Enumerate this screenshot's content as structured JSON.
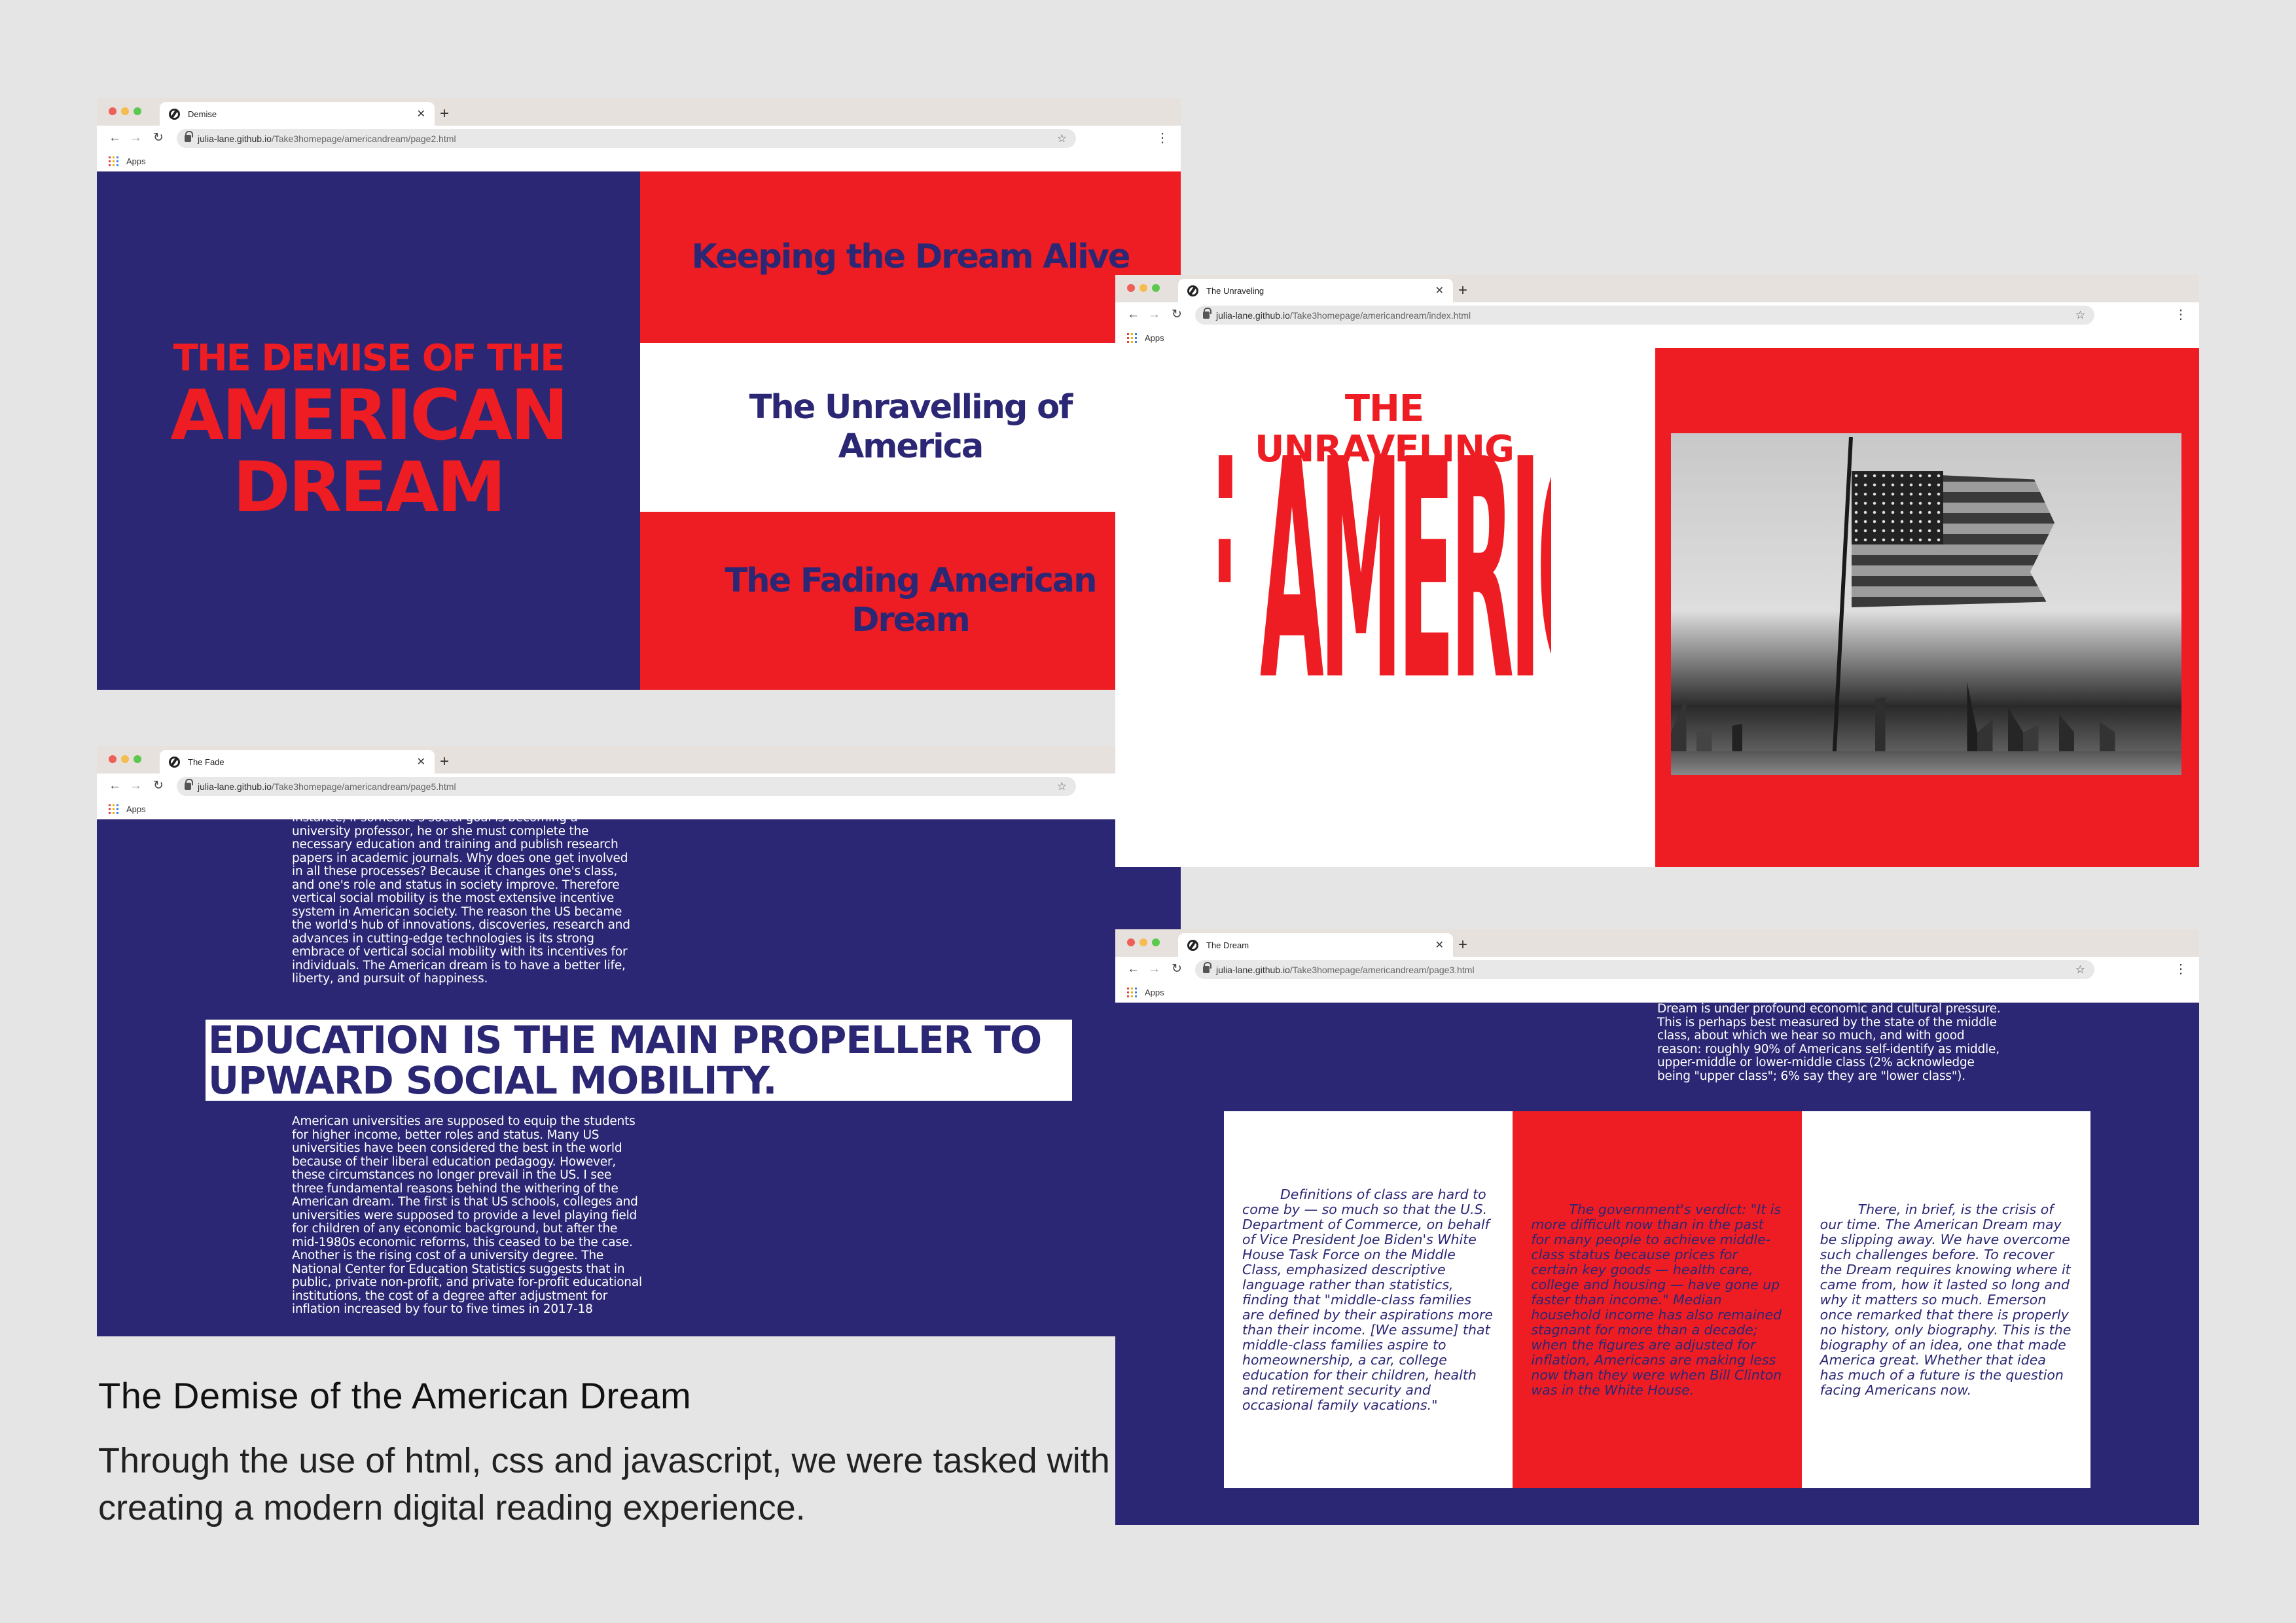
{
  "browser": {
    "apps_label": "Apps",
    "menu_icon": "⋮",
    "star_icon": "☆"
  },
  "window1": {
    "tab_title": "Demise",
    "url_host": "julia-lane.github.io",
    "url_path": "/Take3homepage/americandream/page2.html",
    "title_small": "THE DEMISE OF THE",
    "title_big_1": "AMERICAN",
    "title_big_2": "DREAM",
    "band1": "Keeping the Dream Alive",
    "band2": "The Unravelling of America",
    "band3": "The Fading American Dream"
  },
  "window2": {
    "tab_title": "The Unraveling",
    "url_host": "julia-lane.github.io",
    "url_path": "/Take3homepage/americandream/index.html",
    "title_small": "THE UNRAVELING",
    "title_big": "OF AMERICA"
  },
  "window3": {
    "tab_title": "The Fade",
    "url_host": "julia-lane.github.io",
    "url_path": "/Take3homepage/americandream/page5.html",
    "paragraph1": "instance, if someone's social goal is becoming a university professor, he or she must complete the necessary education and training and publish research papers in academic journals. Why does one get involved in all these processes? Because it changes one's class, and one's role and status in society improve. Therefore vertical social mobility is the most extensive incentive system in American society. The reason the US became the world's hub of innovations, discoveries, research and advances in cutting-edge technologies is its strong embrace of vertical social mobility with its incentives for individuals. The American dream is to have a better life, liberty, and pursuit of happiness.",
    "headline": "EDUCATION IS THE MAIN PROPELLER TO UPWARD SOCIAL MOBILITY.",
    "paragraph2": "American universities are supposed to equip the students for higher income, better roles and status. Many US universities have been considered the best in the world because of their liberal education pedagogy. However, these circumstances no longer prevail in the US. I see three fundamental reasons behind the withering of the American dream. The first is that US schools, colleges and universities were supposed to provide a level playing field for children of any economic background, but after the mid-1980s economic reforms, this ceased to be the case. Another is the rising cost of a university degree. The National Center for Education Statistics suggests that in public, private non-profit, and private for-profit educational institutions, the cost of a degree after adjustment for inflation increased by four to five times in 2017-18"
  },
  "window4": {
    "tab_title": "The Dream",
    "url_host": "julia-lane.github.io",
    "url_path": "/Take3homepage/americandream/page3.html",
    "intro": "Dream is under profound economic and cultural pressure. This is perhaps best measured by the state of the middle class, about which we hear so much, and with good reason: roughly 90% of Americans self-identify as middle, upper-middle or lower-middle class (2% acknowledge being \"upper class\"; 6% say they are \"lower class\").",
    "card1": "Definitions of class are hard to come by — so much so that the U.S. Department of Commerce, on behalf of Vice President Joe Biden's White House Task Force on the Middle Class, emphasized descriptive language rather than statistics, finding that \"middle-class families are defined by their aspirations more than their income. [We assume] that middle-class families aspire to homeownership, a car, college education for their children, health and retirement security and occasional family vacations.\"",
    "card2": "The government's verdict: \"It is more difficult now than in the past for many people to achieve middle-class status because prices for certain key goods — health care, college and housing — have gone up faster than income.\" Median household income has also remained stagnant for more than a decade; when the figures are adjusted for inflation, Americans are making less now than they were when Bill Clinton was in the White House.",
    "card3": "There, in brief, is the crisis of our time. The American Dream may be slipping away. We have overcome such challenges before. To recover the Dream requires knowing where it came from, how it lasted so long and why it matters so much. Emerson once remarked that there is properly no history, only biography. This is the biography of an idea, one that made America great. Whether that idea has much of a future is the question facing Americans now."
  },
  "caption": {
    "title": "The Demise of the American Dream",
    "body": "Through the use of html, css and javascript, we were tasked with creating a modern digital reading experience."
  },
  "colors": {
    "navy": "#2b2774",
    "red": "#ee1d23",
    "background": "#e5e5e5"
  }
}
